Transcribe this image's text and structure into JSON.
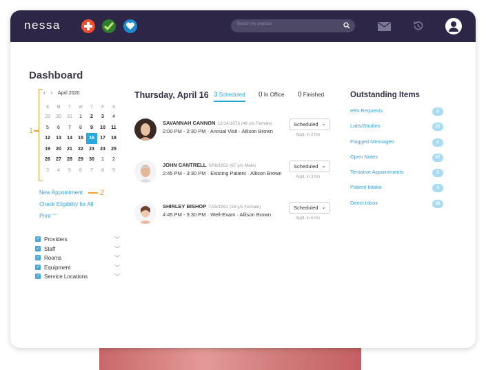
{
  "header": {
    "logo": "nessa",
    "search_placeholder": "Search my practice",
    "icons": [
      "plus-app-icon",
      "check-app-icon",
      "heart-app-icon",
      "search-icon",
      "mail-icon",
      "history-icon",
      "user-icon"
    ],
    "colors": {
      "bar": "#2d2647",
      "accent": "#29a8df",
      "annotation": "#f0a030"
    }
  },
  "dashboard": {
    "title": "Dashboard"
  },
  "annotations": {
    "one": "1",
    "two": "2"
  },
  "calendar": {
    "month": "April 2020",
    "prev_icon": "‹",
    "next_icon": "›",
    "weekdays": [
      "S",
      "M",
      "T",
      "W",
      "T",
      "F",
      "S"
    ],
    "weeks": [
      [
        "29",
        "30",
        "31",
        "1",
        "2",
        "3",
        "4"
      ],
      [
        "5",
        "6",
        "7",
        "8",
        "9",
        "10",
        "11"
      ],
      [
        "12",
        "13",
        "14",
        "15",
        "16",
        "17",
        "18"
      ],
      [
        "19",
        "20",
        "21",
        "22",
        "23",
        "24",
        "25"
      ],
      [
        "26",
        "27",
        "28",
        "29",
        "30",
        "1",
        "2"
      ],
      [
        "3",
        "4",
        "5",
        "6",
        "7",
        "8",
        "9"
      ]
    ],
    "selected": "16"
  },
  "links": {
    "new_appointment": "New Appointment",
    "check_eligibility": "Check Eligibility for All",
    "print": "Print"
  },
  "filters": [
    "Providers",
    "Staff",
    "Rooms",
    "Equipment",
    "Service Locations"
  ],
  "schedule": {
    "date": "Thursday, April 16",
    "tabs": [
      {
        "count": "3",
        "label": "Scheduled"
      },
      {
        "count": "0",
        "label": "In Office"
      },
      {
        "count": "0",
        "label": "Finished"
      }
    ],
    "appointments": [
      {
        "name": "SAVANNAH CANNON",
        "meta": "12/14/1973 (46 y/o Female)",
        "detail": "2:00 PM - 2:30 PM · Annual Visit · Allison Brown",
        "status": "Scheduled",
        "note": "Appt. in 2 hrs"
      },
      {
        "name": "JOHN CANTRELL",
        "meta": "5/06/1952 (67 y/o Male)",
        "detail": "2:45 PM - 3:30 PM · Existing Patient · Allison Brown",
        "status": "Scheduled",
        "note": "Appt. in 3 hrs"
      },
      {
        "name": "SHIRLEY BISHOP",
        "meta": "7/25/1991 (28 y/o Female)",
        "detail": "4:45 PM - 5:30 PM · Well-Exam · Allison Brown",
        "status": "Scheduled",
        "note": "Appt. in 5 hrs"
      }
    ]
  },
  "outstanding": {
    "title": "Outstanding Items",
    "items": [
      {
        "label": "eRx Requests",
        "count": "2"
      },
      {
        "label": "Labs/Studies",
        "count": "22"
      },
      {
        "label": "Flagged Messages",
        "count": "2"
      },
      {
        "label": "Open Notes",
        "count": "37"
      },
      {
        "label": "Tentative Appointments",
        "count": "5"
      },
      {
        "label": "Patient Intake",
        "count": "4"
      },
      {
        "label": "Direct Inbox",
        "count": "36"
      }
    ]
  }
}
